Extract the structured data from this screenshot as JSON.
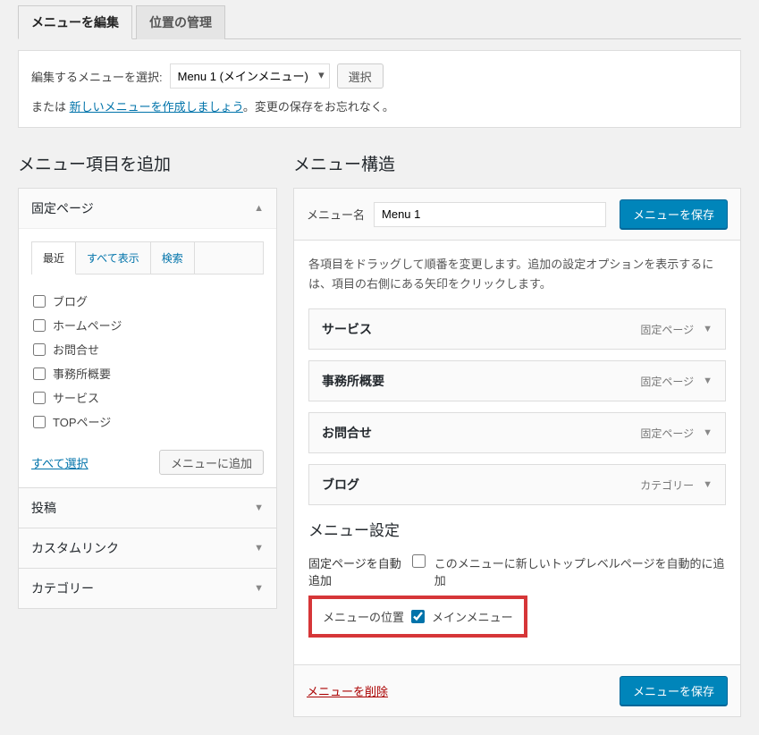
{
  "tabs": {
    "edit": "メニューを編集",
    "locations": "位置の管理"
  },
  "selectBar": {
    "label": "編集するメニューを選択:",
    "option": "Menu 1 (メインメニュー)",
    "button": "選択",
    "or": "または",
    "newLink": "新しいメニューを作成しましょう",
    "tail": "。変更の保存をお忘れなく。"
  },
  "left": {
    "heading": "メニュー項目を追加",
    "sections": {
      "pages": "固定ページ",
      "posts": "投稿",
      "links": "カスタムリンク",
      "cats": "カテゴリー"
    },
    "subtabs": {
      "recent": "最近",
      "all": "すべて表示",
      "search": "検索"
    },
    "checklist": [
      "ブログ",
      "ホームページ",
      "お問合せ",
      "事務所概要",
      "サービス",
      "TOPページ"
    ],
    "selectAll": "すべて選択",
    "addBtn": "メニューに追加"
  },
  "right": {
    "heading": "メニュー構造",
    "nameLabel": "メニュー名",
    "nameValue": "Menu 1",
    "saveBtn": "メニューを保存",
    "desc": "各項目をドラッグして順番を変更します。追加の設定オプションを表示するには、項目の右側にある矢印をクリックします。",
    "items": [
      {
        "title": "サービス",
        "type": "固定ページ"
      },
      {
        "title": "事務所概要",
        "type": "固定ページ"
      },
      {
        "title": "お問合せ",
        "type": "固定ページ"
      },
      {
        "title": "ブログ",
        "type": "カテゴリー"
      }
    ],
    "settingsHeading": "メニュー設定",
    "autoAdd": {
      "label": "固定ページを自動追加",
      "text": "このメニューに新しいトップレベルページを自動的に追加"
    },
    "locations": {
      "label": "メニューの位置",
      "main": "メインメニュー"
    },
    "deleteLink": "メニューを削除"
  }
}
